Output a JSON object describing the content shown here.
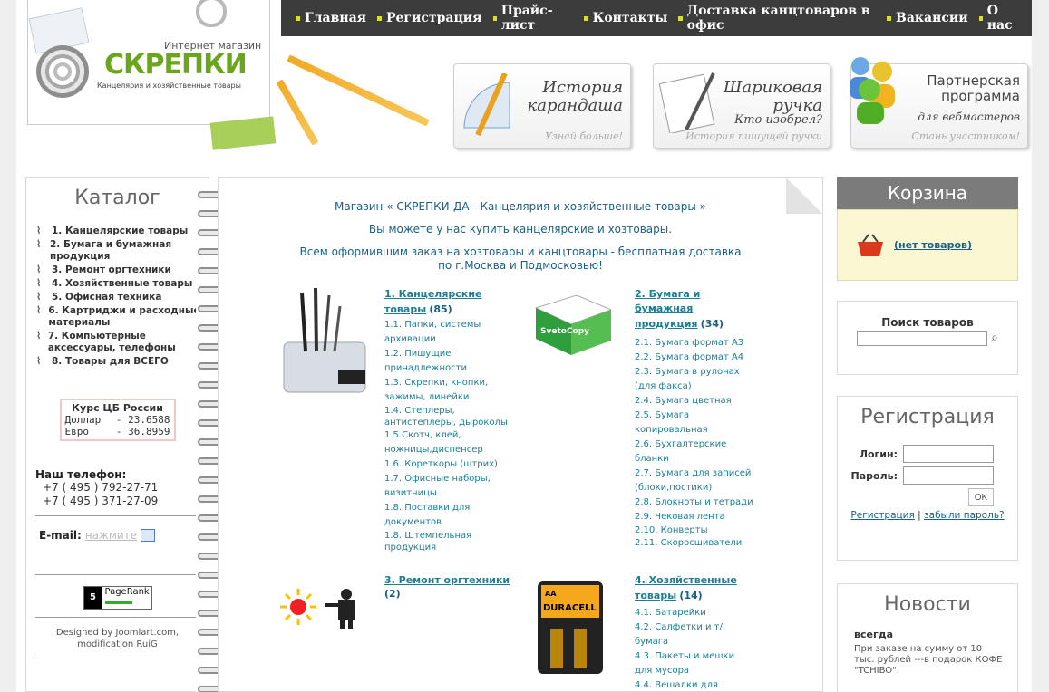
{
  "nav": [
    "Главная",
    "Регистрация",
    "Прайс-лист",
    "Контакты",
    "Доставка канцтоваров в офис",
    "Вакансии",
    "О нас"
  ],
  "logo": {
    "tagline": "Интернет магазин",
    "brand": "СКРЕПКИ",
    "subtitle": "Канцелярия и хозяйственные товары"
  },
  "banners": [
    {
      "title": "История карандаша",
      "caption": "Узнай больше!"
    },
    {
      "title": "Шариковая ручка",
      "title2": "Кто изобрел?",
      "caption": "История пишущей ручки"
    },
    {
      "title": "Партнерская программа",
      "title2": "для вебмастеров",
      "caption": "Стань участником!"
    }
  ],
  "catalog": {
    "title": "Каталог",
    "items": [
      "1. Канцелярские товары",
      "2. Бумага и бумажная продукция",
      "3. Ремонт оргтехники",
      "4. Хозяйственные товары",
      "5. Офисная техника",
      "6. Картриджи и расходные материалы",
      "7. Компьютерные аксессуары, телефоны",
      "8. Товары для ВСЕГО"
    ]
  },
  "rates": {
    "title": "Курс ЦБ России",
    "rows": [
      {
        "name": "Доллар",
        "value": "- 23.6588"
      },
      {
        "name": "Евро",
        "value": "- 36.8959"
      }
    ]
  },
  "phone": {
    "label": "Наш телефон:",
    "numbers": [
      "+7 ( 495 ) 792-27-71",
      "+7 ( 495 ) 371-27-09"
    ]
  },
  "email": {
    "label": "E-mail:",
    "link": "нажмите"
  },
  "pagerank": {
    "value": "5",
    "label": "PageRank",
    "level": 0.5
  },
  "credits": [
    "Designed by Joomlart.com,",
    "modification RuiG"
  ],
  "intro": [
    "Магазин « СКРЕПКИ-ДА - Канцелярия и хозяйственные товары »",
    "Вы можете у нас купить канцелярские и хозтовары.",
    "Всем оформившим заказ на хозтовары и канцтовары - бесплатная доставка",
    "по г.Москва и Подмосковью!"
  ],
  "categories": [
    {
      "title": "1. Канцелярские товары",
      "count": "(85)",
      "subs": [
        "1.1. Папки, системы архивации",
        "1.2. Пишущие принадлежности",
        "1.3. Скрепки, кнопки, зажимы, линейки",
        "1.4. Степлеры, антистеплеры, дыроколы",
        "1.5.Скотч, клей, ножницы,диспенсер",
        "1.6. Кореткоры (штрих)",
        "1.7. Офисные наборы, визитницы",
        "1.8. Поставки для документов",
        "1.8. Штемпельная продукция"
      ]
    },
    {
      "title": "2. Бумага и бумажная продукция",
      "count": "(34)",
      "subs": [
        "2.1. Бумага формат А3",
        "2.2. Бумага формат А4",
        "2.3. Бумага в рулонах (для факса)",
        "2.4. Бумага цветная",
        "2.5. Бумага копировальная",
        "2.6. Бухгалтерские бланки",
        "2.7. Бумага для записей (блоки,постики)",
        "2.8. Блокноты и тетради",
        "2.9. Чековая лента",
        "2.10. Конверты",
        "2.11. Скоросшиватели"
      ]
    },
    {
      "title": "3. Ремонт оргтехники",
      "count": "(2)",
      "subs": []
    },
    {
      "title": "4. Хозяйственные товары",
      "count": "(14)",
      "subs": [
        "4.1. Батарейки",
        "4.2. Салфетки и т/бумага",
        "4.3. Пакеты и мешки для мусора",
        "4.4. Вешалки для"
      ]
    }
  ],
  "cart": {
    "title": "Корзина",
    "empty": "(нет товаров)"
  },
  "search": {
    "label": "Поиск товаров",
    "value": ""
  },
  "register": {
    "title": "Регистрация",
    "login": "Логин:",
    "password": "Пароль:",
    "ok": "OK",
    "reg_link": "Регистрация",
    "separator": "|",
    "forgot_link": "забыли пароль?"
  },
  "news": {
    "title": "Новости",
    "item_title": "всегда",
    "item_text": "При заказе на сумму от 10 тыс. рублей ---в подарок КОФЕ \"TCHIBO\"."
  },
  "product_labels": {
    "paper": "SvetoCopy",
    "battery": "DURACELL",
    "battery_size": "AA"
  }
}
